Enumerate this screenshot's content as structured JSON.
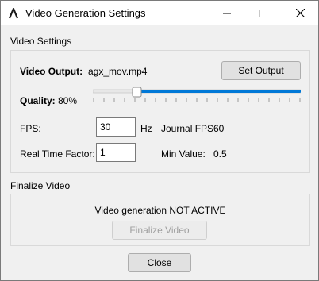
{
  "window": {
    "title": "Video Generation Settings",
    "icon": "agx-logo-icon"
  },
  "video_settings": {
    "section_title": "Video Settings",
    "output_label": "Video Output:",
    "output_value": "agx_mov.mp4",
    "set_output_label": "Set Output",
    "quality_label": "Quality:",
    "quality_value": "80%",
    "quality_fraction": 0.8,
    "fps_label": "FPS:",
    "fps_value": "30",
    "fps_unit": "Hz",
    "journal_fps_label": "Journal FPS",
    "journal_fps_value": "60",
    "rtf_label": "Real Time Factor:",
    "rtf_value": "1",
    "min_value_label": "Min Value:",
    "min_value": "0.5"
  },
  "finalize": {
    "section_title": "Finalize Video",
    "status_text": "Video generation NOT ACTIVE",
    "finalize_label": "Finalize Video"
  },
  "footer": {
    "close_label": "Close"
  },
  "colors": {
    "slider_fill": "#0078d7",
    "slider_track": "#e7e7e7"
  }
}
